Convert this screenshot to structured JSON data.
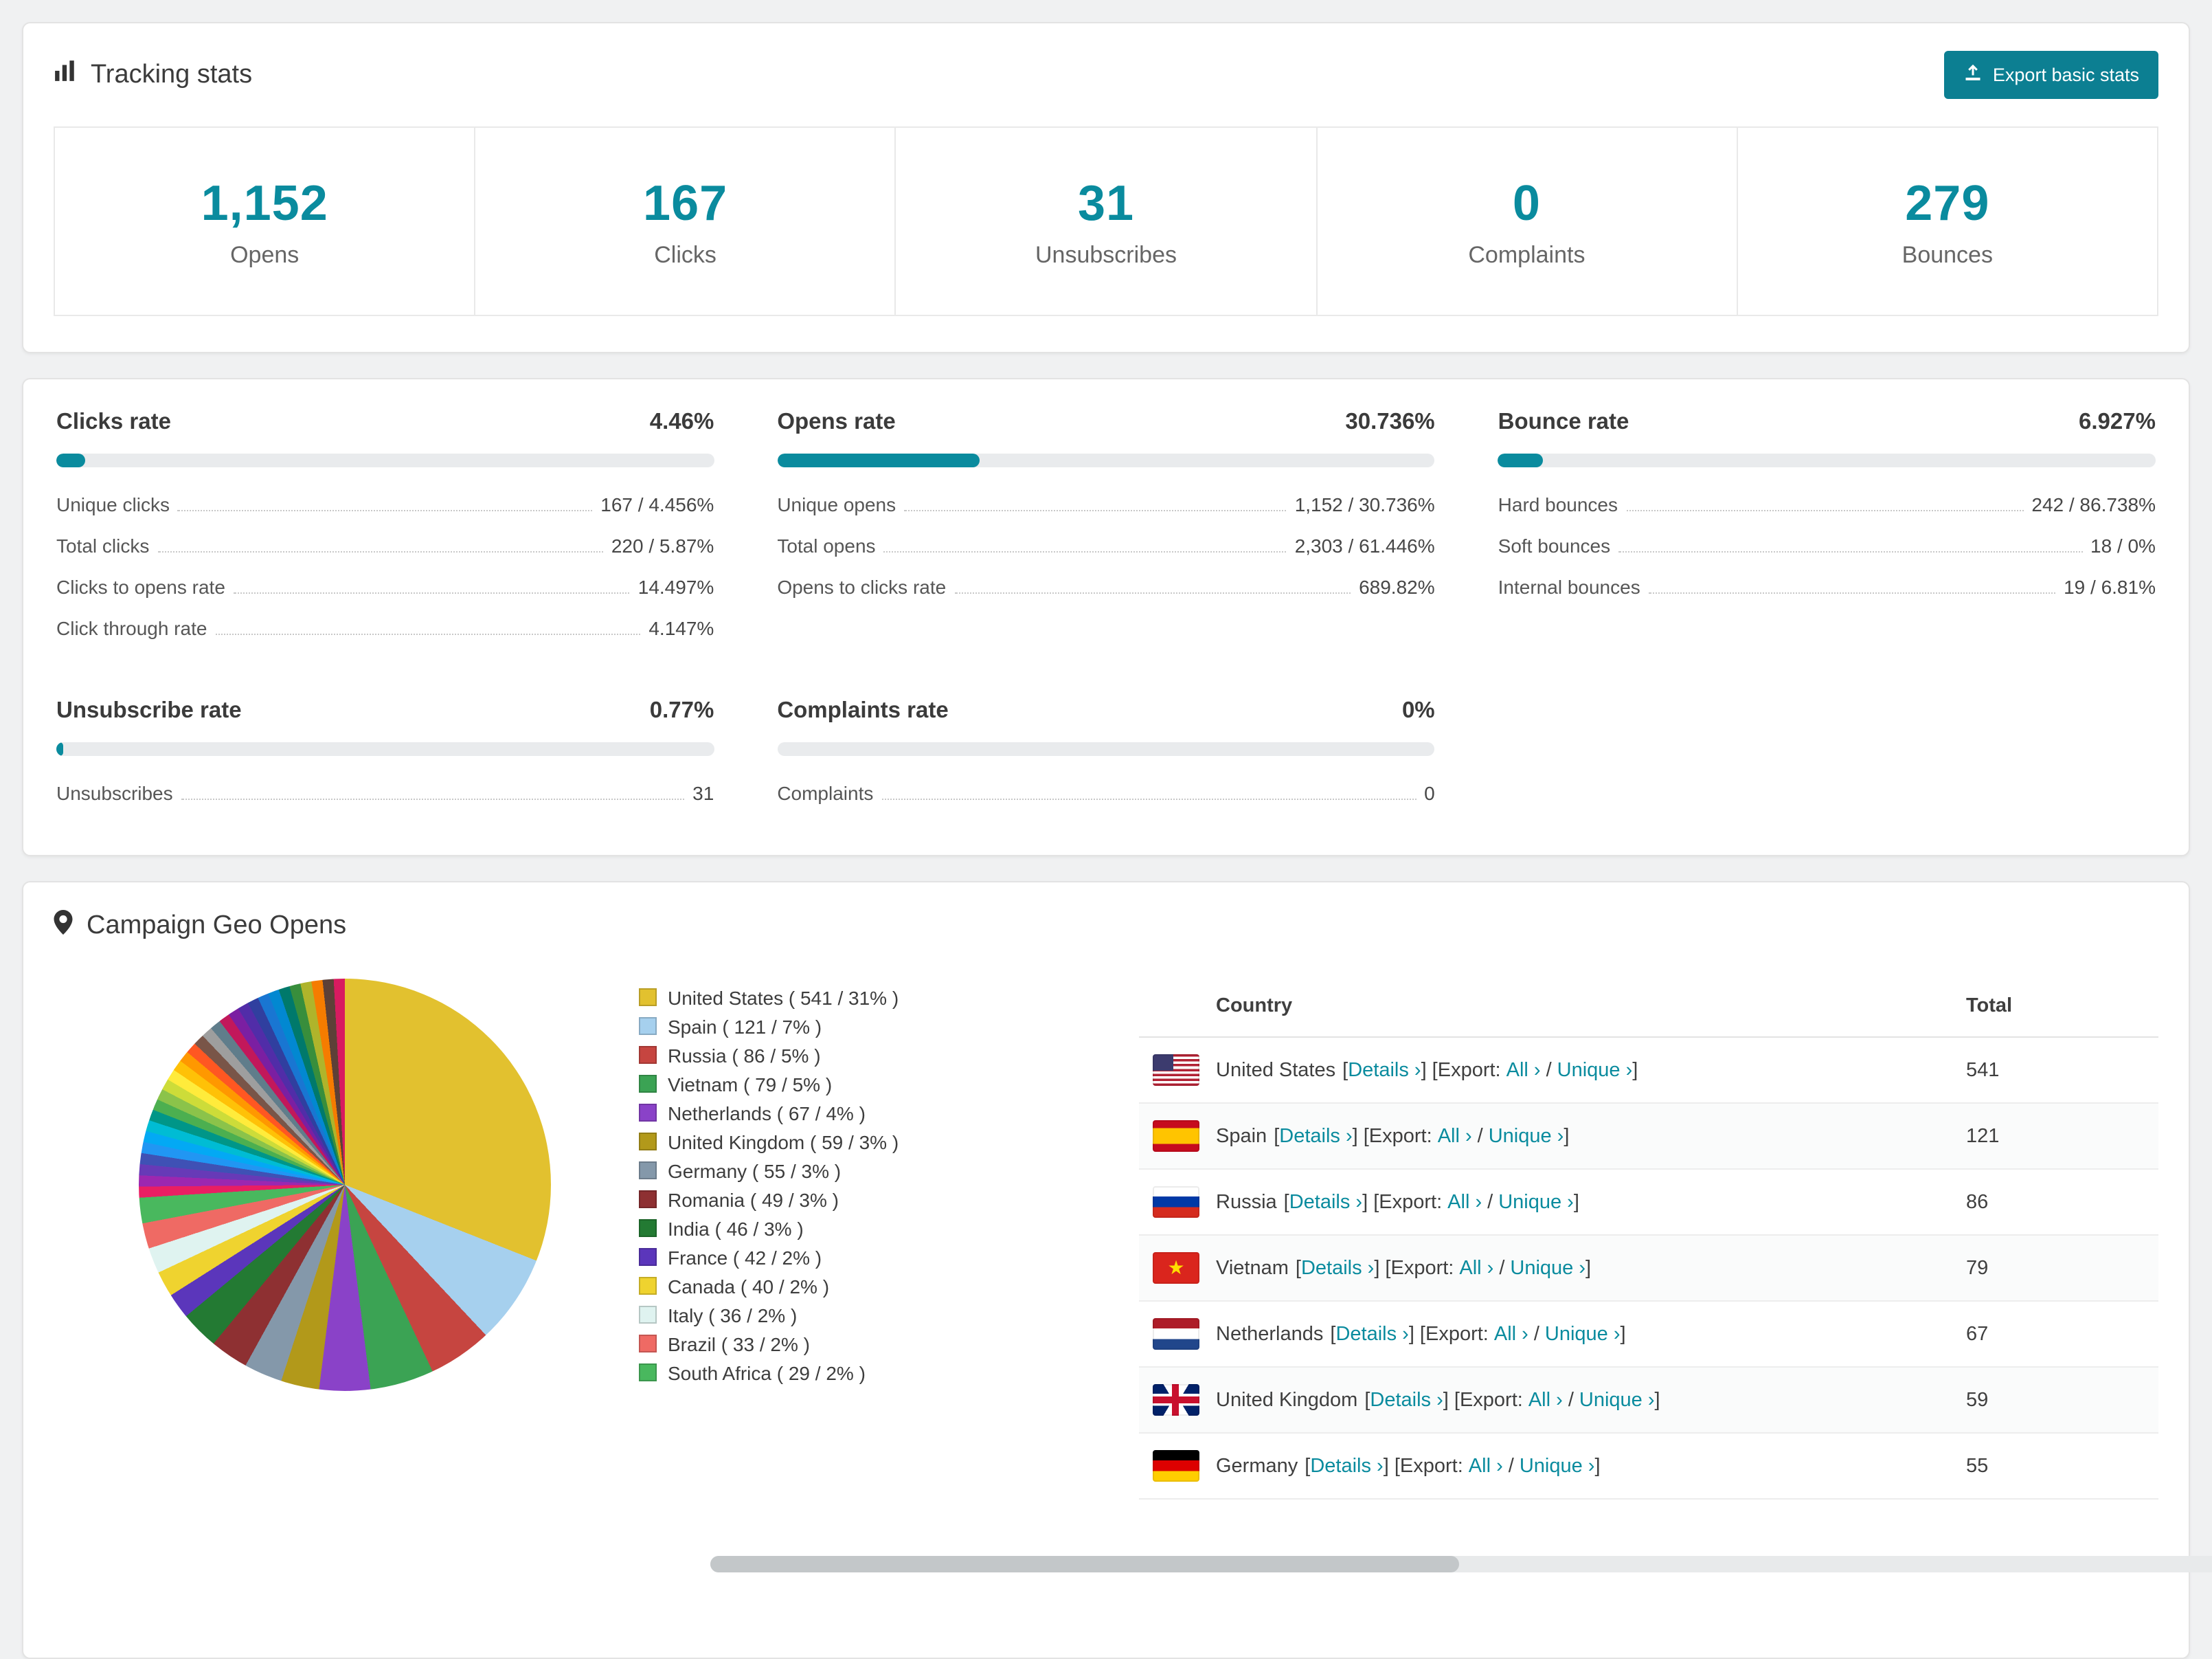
{
  "colors": {
    "accent": "#0a8b9e",
    "button": "#0c7f92"
  },
  "tracking": {
    "title": "Tracking stats",
    "export_button": "Export basic stats",
    "stats": [
      {
        "value": "1,152",
        "label": "Opens"
      },
      {
        "value": "167",
        "label": "Clicks"
      },
      {
        "value": "31",
        "label": "Unsubscribes"
      },
      {
        "value": "0",
        "label": "Complaints"
      },
      {
        "value": "279",
        "label": "Bounces"
      }
    ]
  },
  "rates": [
    {
      "title": "Clicks rate",
      "value": "4.46%",
      "percent": 4.46,
      "rows": [
        {
          "label": "Unique clicks",
          "value": "167 / 4.456%"
        },
        {
          "label": "Total clicks",
          "value": "220 / 5.87%"
        },
        {
          "label": "Clicks to opens rate",
          "value": "14.497%"
        },
        {
          "label": "Click through rate",
          "value": "4.147%"
        }
      ]
    },
    {
      "title": "Opens rate",
      "value": "30.736%",
      "percent": 30.736,
      "rows": [
        {
          "label": "Unique opens",
          "value": "1,152 / 30.736%"
        },
        {
          "label": "Total opens",
          "value": "2,303 / 61.446%"
        },
        {
          "label": "Opens to clicks rate",
          "value": "689.82%"
        }
      ]
    },
    {
      "title": "Bounce rate",
      "value": "6.927%",
      "percent": 6.927,
      "rows": [
        {
          "label": "Hard bounces",
          "value": "242 / 86.738%"
        },
        {
          "label": "Soft bounces",
          "value": "18 / 0%"
        },
        {
          "label": "Internal bounces",
          "value": "19 / 6.81%"
        }
      ]
    },
    {
      "title": "Unsubscribe rate",
      "value": "0.77%",
      "percent": 0.77,
      "rows": [
        {
          "label": "Unsubscribes",
          "value": "31"
        }
      ]
    },
    {
      "title": "Complaints rate",
      "value": "0%",
      "percent": 0,
      "rows": [
        {
          "label": "Complaints",
          "value": "0"
        }
      ]
    }
  ],
  "geo": {
    "title": "Campaign Geo Opens",
    "legend": [
      "United States ( 541 / 31% )",
      "Spain ( 121 / 7% )",
      "Russia ( 86 / 5% )",
      "Vietnam ( 79 / 5% )",
      "Netherlands ( 67 / 4% )",
      "United Kingdom ( 59 / 3% )",
      "Germany ( 55 / 3% )",
      "Romania ( 49 / 3% )",
      "India ( 46 / 3% )",
      "France ( 42 / 2% )",
      "Canada ( 40 / 2% )",
      "Italy ( 36 / 2% )",
      "Brazil ( 33 / 2% )",
      "South Africa ( 29 / 2% )"
    ],
    "table": {
      "col_country": "Country",
      "col_total": "Total",
      "details_label": "Details ›",
      "all_label": "All ›",
      "unique_label": "Unique ›",
      "punct": {
        "open": "[",
        "mid": "] [Export:",
        "slash": "/",
        "close": "]"
      },
      "rows": [
        {
          "country": "United States",
          "total": "541"
        },
        {
          "country": "Spain",
          "total": "121"
        },
        {
          "country": "Russia",
          "total": "86"
        },
        {
          "country": "Vietnam",
          "total": "79"
        },
        {
          "country": "Netherlands",
          "total": "67"
        },
        {
          "country": "United Kingdom",
          "total": "59"
        },
        {
          "country": "Germany",
          "total": "55"
        }
      ]
    }
  },
  "chart_data": {
    "type": "pie",
    "title": "Campaign Geo Opens",
    "legend_position": "right",
    "slices": [
      {
        "label": "United States",
        "value": 541,
        "percent": 31,
        "color": "#e2c12f"
      },
      {
        "label": "Spain",
        "value": 121,
        "percent": 7,
        "color": "#a6d0ee"
      },
      {
        "label": "Russia",
        "value": 86,
        "percent": 5,
        "color": "#c64540"
      },
      {
        "label": "Vietnam",
        "value": 79,
        "percent": 5,
        "color": "#3ba354"
      },
      {
        "label": "Netherlands",
        "value": 67,
        "percent": 4,
        "color": "#8a42c8"
      },
      {
        "label": "United Kingdom",
        "value": 59,
        "percent": 3,
        "color": "#b2991a"
      },
      {
        "label": "Germany",
        "value": 55,
        "percent": 3,
        "color": "#8498aa"
      },
      {
        "label": "Romania",
        "value": 49,
        "percent": 3,
        "color": "#8e3032"
      },
      {
        "label": "India",
        "value": 46,
        "percent": 3,
        "color": "#237a33"
      },
      {
        "label": "France",
        "value": 42,
        "percent": 2,
        "color": "#5b36bb"
      },
      {
        "label": "Canada",
        "value": 40,
        "percent": 2,
        "color": "#efd32f"
      },
      {
        "label": "Italy",
        "value": 36,
        "percent": 2,
        "color": "#dff3f0"
      },
      {
        "label": "Brazil",
        "value": 33,
        "percent": 2,
        "color": "#ef6a64"
      },
      {
        "label": "South Africa",
        "value": 29,
        "percent": 2,
        "color": "#49b85e"
      }
    ],
    "others_percent": 26,
    "others_colors": [
      "#e91e63",
      "#9c27b0",
      "#673ab7",
      "#3f51b5",
      "#2196f3",
      "#03a9f4",
      "#00bcd4",
      "#009688",
      "#4caf50",
      "#8bc34a",
      "#cddc39",
      "#ffeb3b",
      "#ffc107",
      "#ff9800",
      "#ff5722",
      "#795548",
      "#9e9e9e",
      "#607d8b",
      "#c2185b",
      "#7b1fa2",
      "#512da8",
      "#303f9f",
      "#1976d2",
      "#0288d1",
      "#00796b",
      "#388e3c",
      "#afb42b",
      "#f57c00",
      "#5d4037",
      "#d81b60"
    ]
  }
}
